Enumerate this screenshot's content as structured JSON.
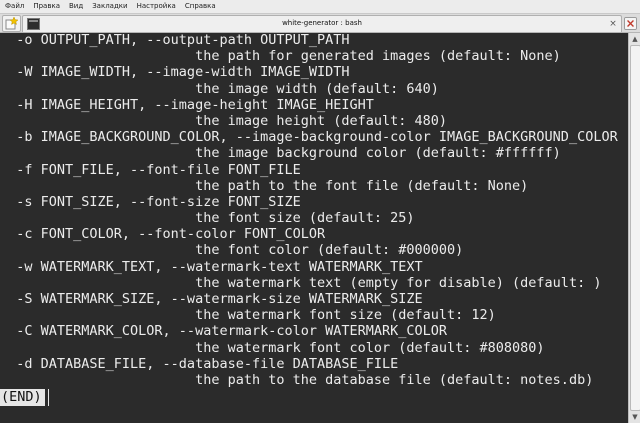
{
  "menu": {
    "items": [
      "Файл",
      "Правка",
      "Вид",
      "Закладки",
      "Настройка",
      "Справка"
    ]
  },
  "tab": {
    "title": "white-generator : bash",
    "close_glyph": "×"
  },
  "window": {
    "close_glyph": "×"
  },
  "terminal": {
    "lines": [
      "  -o OUTPUT_PATH, --output-path OUTPUT_PATH",
      "                        the path for generated images (default: None)",
      "  -W IMAGE_WIDTH, --image-width IMAGE_WIDTH",
      "                        the image width (default: 640)",
      "  -H IMAGE_HEIGHT, --image-height IMAGE_HEIGHT",
      "                        the image height (default: 480)",
      "  -b IMAGE_BACKGROUND_COLOR, --image-background-color IMAGE_BACKGROUND_COLOR",
      "                        the image background color (default: #ffffff)",
      "  -f FONT_FILE, --font-file FONT_FILE",
      "                        the path to the font file (default: None)",
      "  -s FONT_SIZE, --font-size FONT_SIZE",
      "                        the font size (default: 25)",
      "  -c FONT_COLOR, --font-color FONT_COLOR",
      "                        the font color (default: #000000)",
      "  -w WATERMARK_TEXT, --watermark-text WATERMARK_TEXT",
      "                        the watermark text (empty for disable) (default: )",
      "  -S WATERMARK_SIZE, --watermark-size WATERMARK_SIZE",
      "                        the watermark font size (default: 12)",
      "  -C WATERMARK_COLOR, --watermark-color WATERMARK_COLOR",
      "                        the watermark font color (default: #808080)",
      "  -d DATABASE_FILE, --database-file DATABASE_FILE",
      "                        the path to the database file (default: notes.db)"
    ],
    "end_prompt": "(END)"
  },
  "scrollbar": {
    "up_glyph": "▲",
    "down_glyph": "▼"
  },
  "colors": {
    "terminal_bg": "#2b2b2b",
    "terminal_fg": "#ececec",
    "pager_prompt_bg": "#e6e6e6"
  }
}
